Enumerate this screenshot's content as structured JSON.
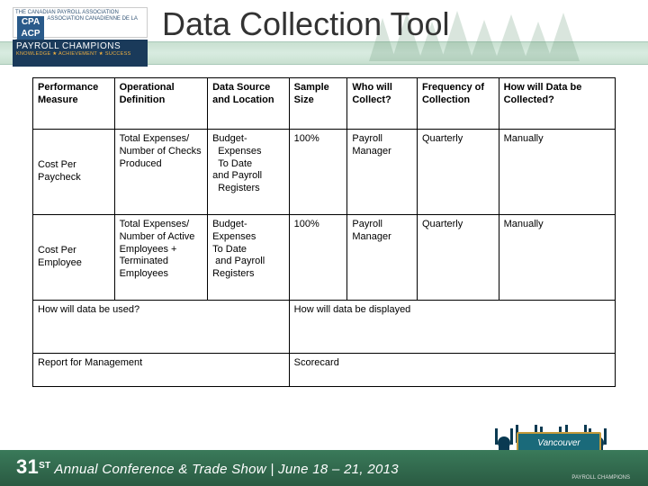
{
  "title": "Data Collection Tool",
  "logos": {
    "cpa_left": "THE CANADIAN PAYROLL ASSOCIATION",
    "cpa_mid": "CPA ACP",
    "cpa_right": "ASSOCIATION CANADIENNE DE LA PAIE",
    "champ_main": "PAYROLL CHAMPIONS",
    "champ_sub": "KNOWLEDGE ★ ACHIEVEMENT ★ SUCCESS"
  },
  "headers": {
    "c1": "Performance Measure",
    "c2": "Operational Definition",
    "c3": "Data Source and Location",
    "c4": "Sample Size",
    "c5": "Who will Collect?",
    "c6": "Frequency of Collection",
    "c7": "How will Data be Collected?"
  },
  "rows": [
    {
      "c1": "Cost Per Paycheck",
      "c2": "Total Expenses/\nNumber of Checks Produced",
      "c3": "Budget-\n  Expenses\n  To Date\nand Payroll\n  Registers",
      "c4": "100%",
      "c5": "Payroll Manager",
      "c6": "Quarterly",
      "c7": "Manually"
    },
    {
      "c1": "Cost Per Employee",
      "c2": "Total Expenses/\nNumber of Active Employees + Terminated Employees",
      "c3": "Budget-\nExpenses\nTo Date\n and Payroll Registers",
      "c4": "100%",
      "c5": "Payroll Manager",
      "c6": "Quarterly",
      "c7": "Manually"
    }
  ],
  "wide1": {
    "left": "How will data be used?",
    "right": "How will data be displayed"
  },
  "wide2": {
    "left": "Report for Management",
    "right": "Scorecard"
  },
  "footer": {
    "num": "31",
    "sup": "ST",
    "rest": "Annual Conference & Trade Show  |  June 18 – 21, 2013",
    "badge": "Vancouver",
    "pc": "PAYROLL CHAMPIONS"
  }
}
